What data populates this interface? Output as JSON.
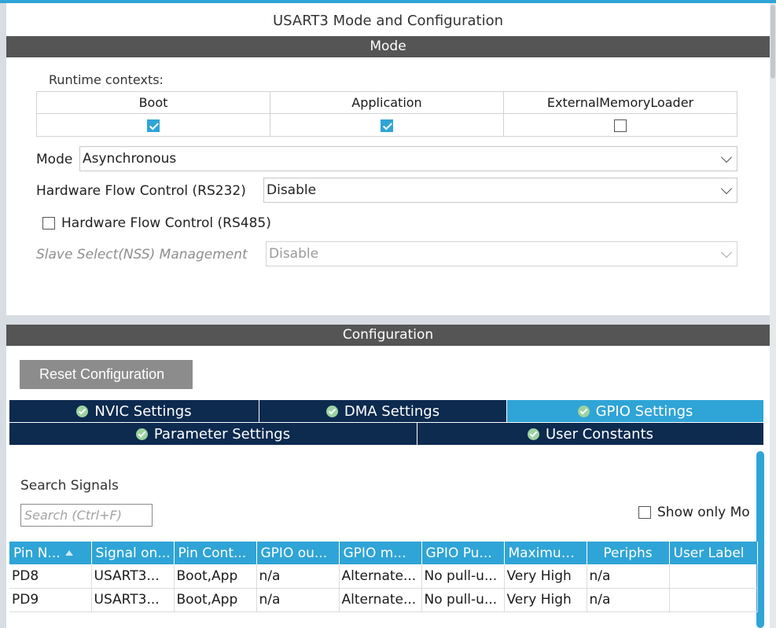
{
  "window": {
    "title": "USART3 Mode and Configuration"
  },
  "mode_section": {
    "header": "Mode",
    "runtime_contexts_label": "Runtime contexts:",
    "contexts": [
      {
        "name": "Boot",
        "checked": true
      },
      {
        "name": "Application",
        "checked": true
      },
      {
        "name": "ExternalMemoryLoader",
        "checked": false
      }
    ],
    "mode": {
      "label": "Mode",
      "value": "Asynchronous"
    },
    "hw_flow_rs232": {
      "label": "Hardware Flow Control (RS232)",
      "value": "Disable"
    },
    "hw_flow_rs485": {
      "label": "Hardware Flow Control (RS485)",
      "checked": false
    },
    "slave_select": {
      "label": "Slave Select(NSS) Management",
      "value": "Disable",
      "disabled": true
    }
  },
  "config_section": {
    "header": "Configuration",
    "reset_button": "Reset Configuration",
    "tabs_row1": [
      {
        "label": "NVIC Settings",
        "active": false
      },
      {
        "label": "DMA Settings",
        "active": false
      },
      {
        "label": "GPIO Settings",
        "active": true
      }
    ],
    "tabs_row2": [
      {
        "label": "Parameter Settings",
        "active": false
      },
      {
        "label": "User Constants",
        "active": false
      }
    ],
    "search": {
      "label": "Search Signals",
      "placeholder": "Search (Ctrl+F)"
    },
    "show_only_label": "Show only Mo",
    "table": {
      "columns": [
        "Pin N...",
        "Signal on...",
        "Pin Cont...",
        "GPIO ou...",
        "GPIO m...",
        "GPIO Pu...",
        "Maximum...",
        "Periphs",
        "User Label"
      ],
      "rows": [
        [
          "PD8",
          "USART3...",
          "Boot,App",
          "n/a",
          "Alternate...",
          "No pull-u...",
          "Very High",
          "n/a",
          ""
        ],
        [
          "PD9",
          "USART3...",
          "Boot,App",
          "n/a",
          "Alternate...",
          "No pull-u...",
          "Very High",
          "n/a",
          ""
        ]
      ]
    }
  },
  "colors": {
    "accent": "#2fa4d6",
    "tab_dark": "#0d2a4f",
    "section_bar": "#555555"
  }
}
